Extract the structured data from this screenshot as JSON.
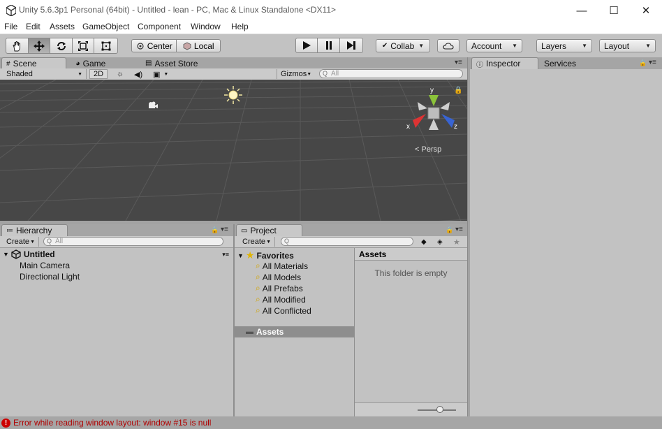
{
  "window": {
    "title": "Unity 5.6.3p1 Personal (64bit) - Untitled - lean - PC, Mac & Linux Standalone <DX11>",
    "minimize": "—",
    "maximize": "☐",
    "close": "✕"
  },
  "menu": [
    "File",
    "Edit",
    "Assets",
    "GameObject",
    "Component",
    "Window",
    "Help"
  ],
  "toolbar": {
    "tools": [
      "hand-tool",
      "move-tool",
      "rotate-tool",
      "scale-tool",
      "rect-tool"
    ],
    "pivot": "Center",
    "space": "Local",
    "collab": "Collab",
    "account": "Account",
    "layers": "Layers",
    "layout": "Layout"
  },
  "scene": {
    "tabs": [
      "Scene",
      "Game",
      "Asset Store"
    ],
    "shading": "Shaded",
    "mode2d": "2D",
    "gizmos": "Gizmos",
    "search_placeholder": "All",
    "persp": "Persp",
    "axes": {
      "x": "x",
      "y": "y",
      "z": "z"
    }
  },
  "hierarchy": {
    "tab": "Hierarchy",
    "create": "Create",
    "search_placeholder": "All",
    "scene_name": "Untitled",
    "items": [
      "Main Camera",
      "Directional Light"
    ]
  },
  "project": {
    "tab": "Project",
    "create": "Create",
    "favorites_label": "Favorites",
    "favorites": [
      "All Materials",
      "All Models",
      "All Prefabs",
      "All Modified",
      "All Conflicted"
    ],
    "assets_label": "Assets",
    "content_header": "Assets",
    "empty_message": "This folder is empty"
  },
  "inspector": {
    "tabs": [
      "Inspector",
      "Services"
    ]
  },
  "status": {
    "message": "Error while reading window layout: window #15 is null",
    "error_color": "#cc0000"
  }
}
